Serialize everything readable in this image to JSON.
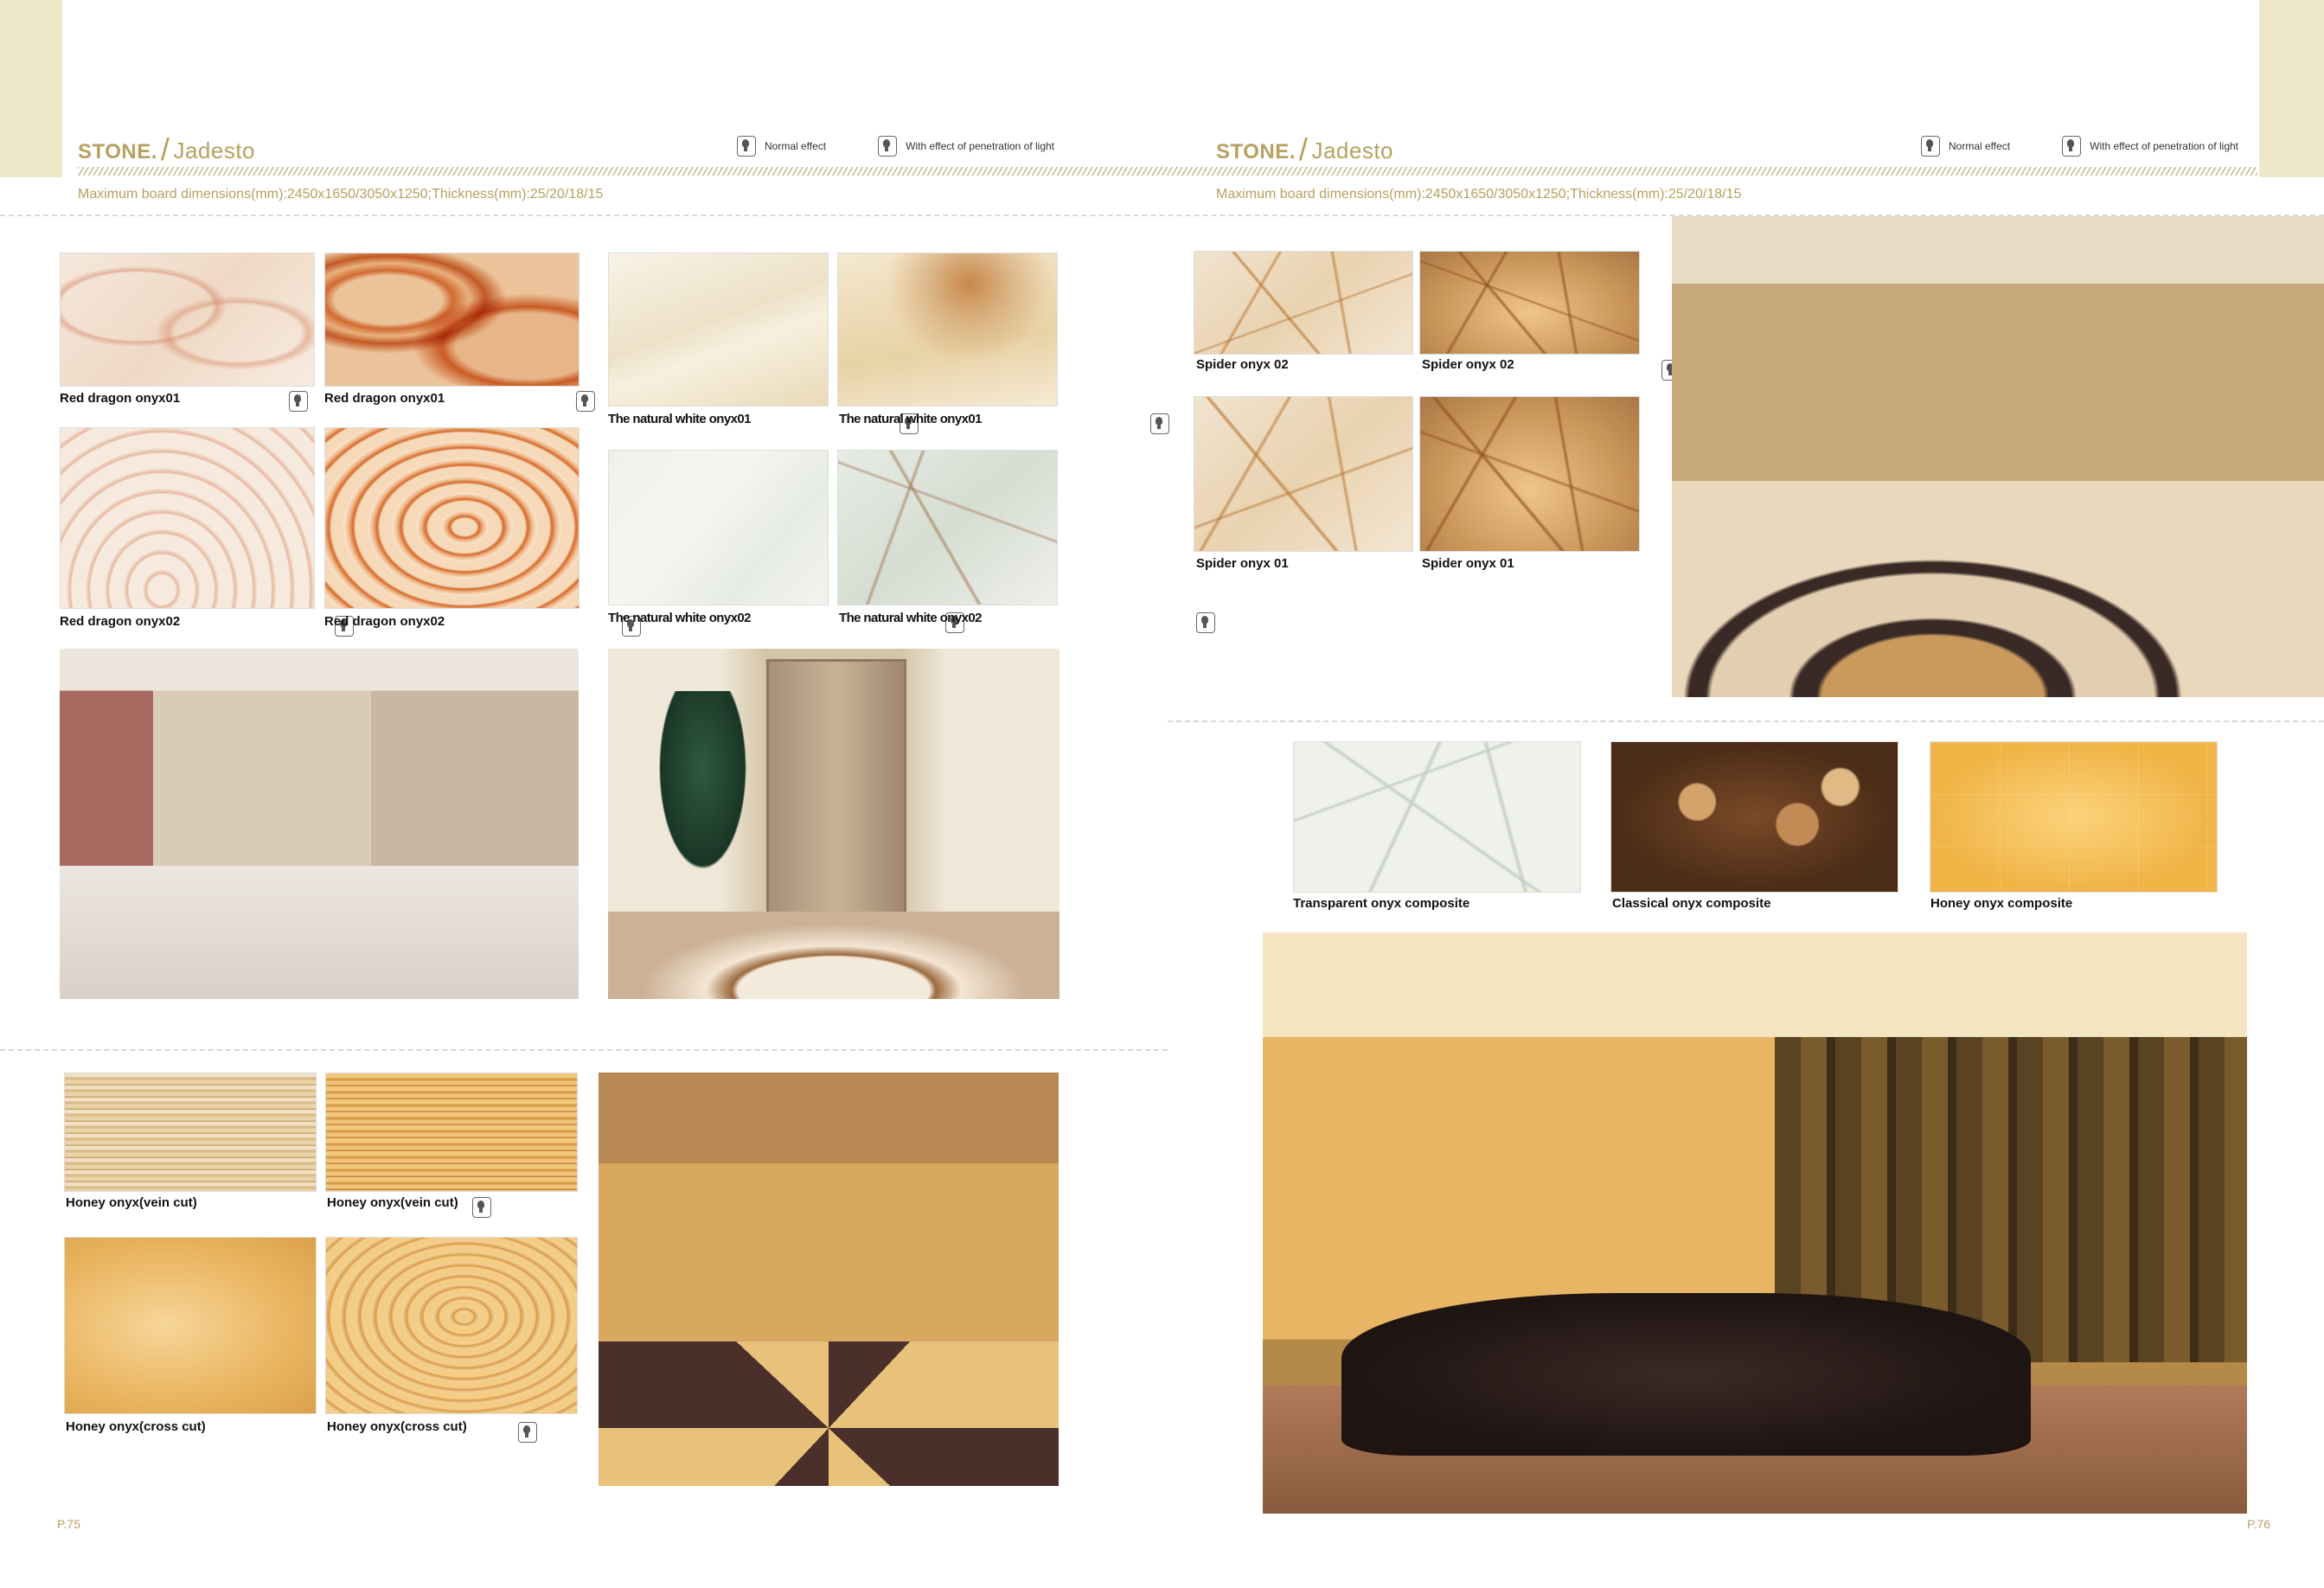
{
  "header": {
    "brand": "STONE.",
    "sub": "Jadesto",
    "legend_normal": "Normal effect",
    "legend_light": "With effect of penetration of light",
    "dimensions": "Maximum board dimensions(mm):2450x1650/3050x1250;Thickness(mm):25/20/18/15"
  },
  "left_page": {
    "page_number": "P.75",
    "red_dragon": [
      {
        "label": "Red dragon onyx01",
        "label_lit": "Red dragon onyx01"
      },
      {
        "label": "Red dragon onyx02",
        "label_lit": "Red dragon onyx02"
      }
    ],
    "natural_white": [
      {
        "label": "The natural white onyx01",
        "label_lit": "The natural white onyx01"
      },
      {
        "label": "The natural white onyx02",
        "label_lit": "The natural white onyx02"
      }
    ],
    "honey": [
      {
        "label": "Honey onyx(vein cut)",
        "label_lit": "Honey onyx(vein cut)"
      },
      {
        "label": "Honey onyx(cross cut)",
        "label_lit": "Honey onyx(cross cut)"
      }
    ]
  },
  "right_page": {
    "page_number": "P.76",
    "spider": [
      {
        "label": "Spider onyx 02",
        "label_lit": "Spider onyx 02"
      },
      {
        "label": "Spider onyx 01",
        "label_lit": "Spider onyx 01"
      }
    ],
    "composites": [
      {
        "label": "Transparent onyx composite"
      },
      {
        "label": "Classical onyx composite"
      },
      {
        "label": "Honey onyx composite"
      }
    ]
  },
  "colors": {
    "accent": "#b7a15f",
    "tab": "#efe8c8"
  },
  "icons": {
    "legend": "lightbulb-icon"
  }
}
